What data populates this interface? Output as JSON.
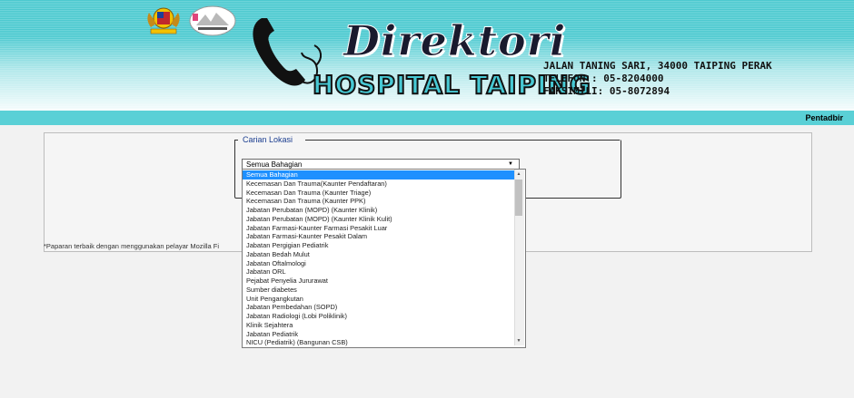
{
  "header": {
    "title_script": "Direktori",
    "title_main": "HOSPITAL TAIPING",
    "address": "JALAN TANING SARI, 34000 TAIPING PERAK",
    "phone": "TELEFON : 05-8204000",
    "fax": "FAKSIMILI: 05-8072894"
  },
  "nav": {
    "admin_label": "Pentadbir"
  },
  "search": {
    "legend": "Carian Lokasi",
    "selected": "Semua Bahagian",
    "options": [
      "Semua Bahagian",
      "Kecemasan Dan Trauma(Kaunter Pendaftaran)",
      "Kecemasan Dan Trauma (Kaunter Triage)",
      "Kecemasan Dan Trauma (Kaunter PPK)",
      "Jabatan Perubatan (MOPD) (Kaunter Klinik)",
      "Jabatan Perubatan (MOPD) (Kaunter Klinik Kulit)",
      "Jabatan Farmasi-Kaunter Farmasi Pesakit Luar",
      "Jabatan Farmasi-Kaunter Pesakit Dalam",
      "Jabatan Pergigian Pediatrik",
      "Jabatan Bedah Mulut",
      "Jabatan Oftalmologi",
      "Jabatan ORL",
      "Pejabat Penyelia Jururawat",
      "Sumber diabetes",
      "Unit Pengangkutan",
      "Jabatan Pembedahan (SOPD)",
      "Jabatan Radiologi (Lobi Poliklinik)",
      "Klinik Sejahtera",
      "Jabatan Pediatrik",
      "NICU (Pediatrik) (Bangunan CSB)"
    ]
  },
  "note": "*Paparan terbaik dengan menggunakan pelayar Mozilla Fi",
  "colors": {
    "header": "#4cc9cf",
    "navbar": "#5ad0d6",
    "selected_option": "#1e90ff"
  }
}
